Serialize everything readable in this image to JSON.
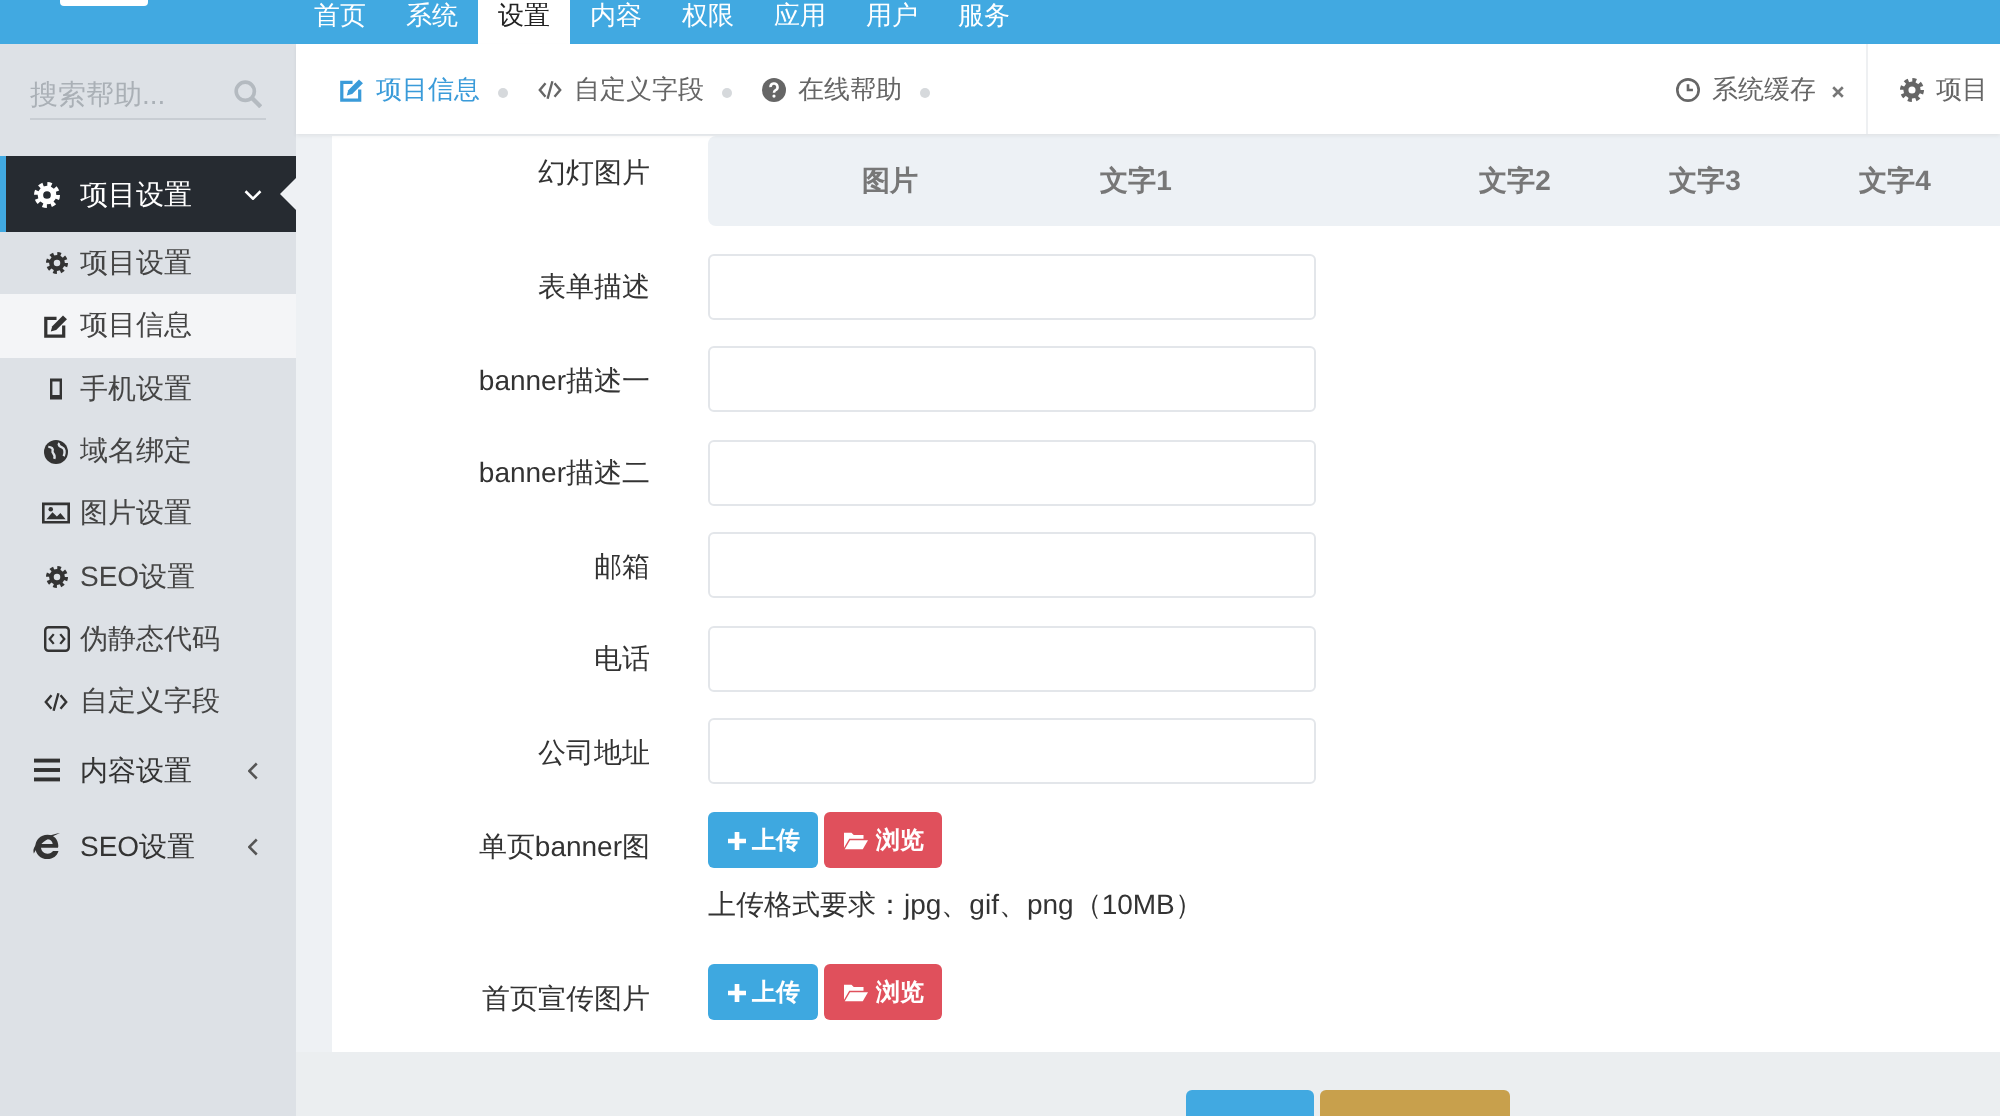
{
  "top_nav": {
    "items": [
      {
        "label": "首页",
        "selected": false
      },
      {
        "label": "系统",
        "selected": false
      },
      {
        "label": "设置",
        "selected": true
      },
      {
        "label": "内容",
        "selected": false
      },
      {
        "label": "权限",
        "selected": false
      },
      {
        "label": "应用",
        "selected": false
      },
      {
        "label": "用户",
        "selected": false
      },
      {
        "label": "服务",
        "selected": false
      }
    ]
  },
  "sidebar": {
    "search": {
      "placeholder": "搜索帮助..."
    },
    "groups": [
      {
        "label": "项目设置",
        "expanded": true,
        "children": [
          {
            "label": "项目设置",
            "selected": false
          },
          {
            "label": "项目信息",
            "selected": true
          },
          {
            "label": "手机设置",
            "selected": false
          },
          {
            "label": "域名绑定",
            "selected": false
          },
          {
            "label": "图片设置",
            "selected": false
          },
          {
            "label": "SEO设置",
            "selected": false
          },
          {
            "label": "伪静态代码",
            "selected": false
          },
          {
            "label": "自定义字段",
            "selected": false
          }
        ]
      },
      {
        "label": "内容设置",
        "expanded": false
      },
      {
        "label": "SEO设置",
        "expanded": false
      }
    ]
  },
  "page_tabs": [
    {
      "label": "项目信息",
      "selected": true
    },
    {
      "label": "自定义字段",
      "selected": false
    },
    {
      "label": "在线帮助",
      "selected": false
    }
  ],
  "pinned_tabs": [
    {
      "label": "系统缓存",
      "closable": true
    },
    {
      "label": "项目",
      "closable": false
    }
  ],
  "form": {
    "fields": [
      {
        "kind": "slides",
        "label": "幻灯图片",
        "columns": [
          "图片",
          "文字1",
          "文字2",
          "文字3",
          "文字4"
        ]
      },
      {
        "kind": "text",
        "label": "表单描述"
      },
      {
        "kind": "text",
        "label": "banner描述一"
      },
      {
        "kind": "text",
        "label": "banner描述二"
      },
      {
        "kind": "text",
        "label": "邮箱"
      },
      {
        "kind": "text",
        "label": "电话"
      },
      {
        "kind": "text",
        "label": "公司地址"
      },
      {
        "kind": "upload",
        "label": "单页banner图",
        "buttons": [
          {
            "kind": "upload",
            "label": "上传"
          },
          {
            "kind": "browse",
            "label": "浏览"
          }
        ],
        "hint": "上传格式要求：jpg、gif、png（10MB）"
      },
      {
        "kind": "upload",
        "label": "首页宣传图片",
        "buttons": [
          {
            "kind": "upload",
            "label": "上传"
          },
          {
            "kind": "browse",
            "label": "浏览"
          }
        ]
      }
    ]
  }
}
